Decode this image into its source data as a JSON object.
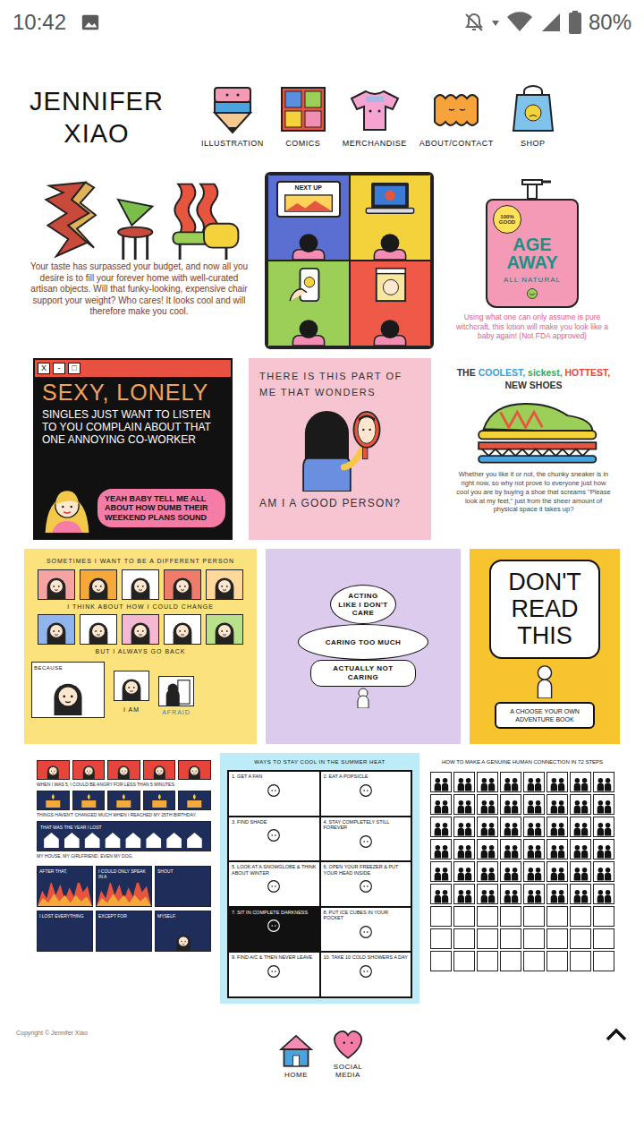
{
  "status_bar": {
    "time": "10:42",
    "battery": "80%"
  },
  "logo": {
    "lines": [
      "JENNIFER",
      "XIAO"
    ]
  },
  "nav": [
    {
      "label": "ILLUSTRATION"
    },
    {
      "label": "COMICS"
    },
    {
      "label": "MERCHANDISE"
    },
    {
      "label": "ABOUT/CONTACT"
    },
    {
      "label": "SHOP"
    }
  ],
  "tiles": [
    {
      "kind": "chairs",
      "caption": "Your taste has surpassed your budget, and now all you desire is to fill your forever home with well-curated artisan objects. Will that funky-looking, expensive chair support your weight? Who cares! It looks cool and will therefore make you cool."
    },
    {
      "kind": "screens",
      "screen_label": "NEXT UP"
    },
    {
      "kind": "lotion",
      "badge": "100% GOOD",
      "brand": "AGE AWAY",
      "sub": "ALL NATURAL",
      "caption": "Using what one can only assume is pure witchcraft, this lotion will make you look like a baby again! (Not FDA approved)"
    },
    {
      "kind": "dating",
      "window_buttons": [
        "X",
        "-",
        "□"
      ],
      "headline": "SEXY, LONELY",
      "body": "SINGLES JUST WANT TO LISTEN TO YOU COMPLAIN ABOUT THAT ONE ANNOYING CO-WORKER",
      "bubble": "YEAH BABY TELL ME ALL ABOUT HOW DUMB THEIR WEEKEND PLANS SOUND"
    },
    {
      "kind": "mirror",
      "top": "THERE IS THIS PART OF ME THAT WONDERS",
      "bottom": "AM I A GOOD PERSON?"
    },
    {
      "kind": "shoes",
      "headline": [
        {
          "text": "THE",
          "color": "#333333"
        },
        {
          "text": "COOLEST,",
          "color": "#3a9fd8"
        },
        {
          "text": "sickest,",
          "color": "#35a85a"
        },
        {
          "text": "HOTTEST,",
          "color": "#e8453a"
        },
        {
          "text": "NEW SHOES",
          "color": "#333333"
        }
      ],
      "caption": "Whether you like it or not, the chunky sneaker is in right now, so why not prove to everyone just how cool you are by buying a shoe that screams \"Please look at my feet,\" just from the sheer amount of physical space it takes up?"
    },
    {
      "kind": "change",
      "lines": [
        "SOMETIMES I WANT TO BE A DIFFERENT PERSON",
        "I THINK ABOUT HOW I COULD CHANGE",
        "BUT I ALWAYS GO BACK"
      ],
      "because": "BECAUSE",
      "i_am": "I AM",
      "afraid": "AFRAID"
    },
    {
      "kind": "caring",
      "bubbles": [
        "ACTING LIKE I DON'T CARE",
        "CARING TOO MUCH",
        "ACTUALLY NOT CARING"
      ]
    },
    {
      "kind": "book",
      "title": "DON'T READ THIS",
      "label": "A CHOOSE YOUR OWN ADVENTURE BOOK"
    },
    {
      "kind": "anger",
      "caption_1": "WHEN I WAS 5, I COULD BE ANGRY FOR LESS THAN 5 MINUTES.",
      "caption_2": "THINGS HAVEN'T CHANGED MUCH WHEN I REACHED MY 25TH BIRTHDAY.",
      "house_panel": "THAT WAS THE YEAR I LOST",
      "caption_3": "MY HOUSE, MY GIRLFRIEND, EVEN MY DOG.",
      "fire_panels": [
        {
          "text": "AFTER THAT,",
          "kind": "fire"
        },
        {
          "text": "I COULD ONLY SPEAK IN A",
          "kind": "fire"
        },
        {
          "text": "SHOUT",
          "kind": "dark"
        }
      ],
      "last_panels": [
        {
          "text": "I LOST EVERYTHING",
          "kind": "dark"
        },
        {
          "text": "EXCEPT FOR",
          "kind": "dark"
        },
        {
          "text": "MYSELF.",
          "kind": "face"
        }
      ]
    },
    {
      "kind": "summer",
      "title": "WAYS TO STAY COOL IN THE SUMMER HEAT",
      "steps": [
        {
          "text": "1. GET A FAN",
          "dark": false
        },
        {
          "text": "2. EAT A POPSICLE",
          "dark": false
        },
        {
          "text": "3. FIND SHADE",
          "dark": false
        },
        {
          "text": "4. STAY COMPLETELY STILL FOREVER",
          "dark": false
        },
        {
          "text": "5. LOOK AT A SNOWGLOBE & THINK ABOUT WINTER",
          "dark": false
        },
        {
          "text": "6. OPEN YOUR FREEZER & PUT YOUR HEAD INSIDE",
          "dark": false
        },
        {
          "text": "7. SIT IN COMPLETE DARKNESS",
          "dark": true
        },
        {
          "text": "8. PUT ICE CUBES IN YOUR POCKET",
          "dark": false
        },
        {
          "text": "9. FIND A/C & THEN NEVER LEAVE",
          "dark": false
        },
        {
          "text": "10. TAKE 10 COLD SHOWERS A DAY",
          "dark": false
        }
      ]
    },
    {
      "kind": "steps",
      "title": "HOW TO MAKE A GENUINE HUMAN CONNECTION IN 72 STEPS",
      "panel_count": 72,
      "filled_count": 48
    }
  ],
  "footer": {
    "copyright": "Copyright © Jennifer Xiao",
    "nav": [
      {
        "label": "HOME"
      },
      {
        "label": "SOCIAL MEDIA"
      }
    ]
  }
}
